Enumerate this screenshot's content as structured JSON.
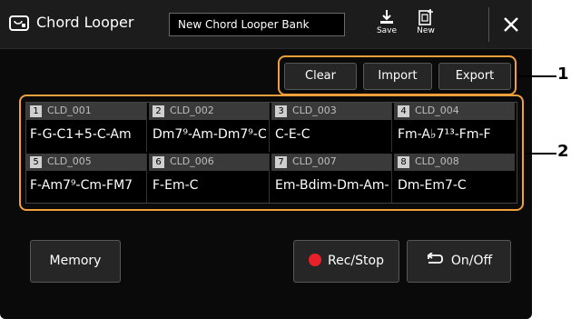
{
  "titlebar": {
    "title": "Chord Looper",
    "bank_name": "New Chord Looper Bank",
    "save_label": "Save",
    "new_label": "New",
    "close_glyph": "✕"
  },
  "actions": {
    "clear": "Clear",
    "import": "Import",
    "export": "Export"
  },
  "slots": [
    {
      "num": "1",
      "id": "CLD_001",
      "chords": "F-G-C1+5-C-Am"
    },
    {
      "num": "2",
      "id": "CLD_002",
      "chords": "Dm7⁹-Am-Dm7⁹-C"
    },
    {
      "num": "3",
      "id": "CLD_003",
      "chords": "C-E-C"
    },
    {
      "num": "4",
      "id": "CLD_004",
      "chords": "Fm-A♭7¹³-Fm-F"
    },
    {
      "num": "5",
      "id": "CLD_005",
      "chords": "F-Am7⁹-Cm-FM7"
    },
    {
      "num": "6",
      "id": "CLD_006",
      "chords": "F-Em-C"
    },
    {
      "num": "7",
      "id": "CLD_007",
      "chords": "Em-Bdim-Dm-Am-"
    },
    {
      "num": "8",
      "id": "CLD_008",
      "chords": "Dm-Em7-C"
    }
  ],
  "bottom": {
    "memory": "Memory",
    "rec_stop": "Rec/Stop",
    "on_off": "On/Off"
  },
  "callouts": {
    "one": "1",
    "two": "2"
  },
  "colors": {
    "highlight": "#f2a03c",
    "rec": "#e8202a",
    "panel": "#0a0a0a"
  },
  "icons": [
    "chord-looper-icon",
    "save-icon",
    "new-icon",
    "close-icon",
    "record-dot-icon",
    "loop-icon"
  ]
}
